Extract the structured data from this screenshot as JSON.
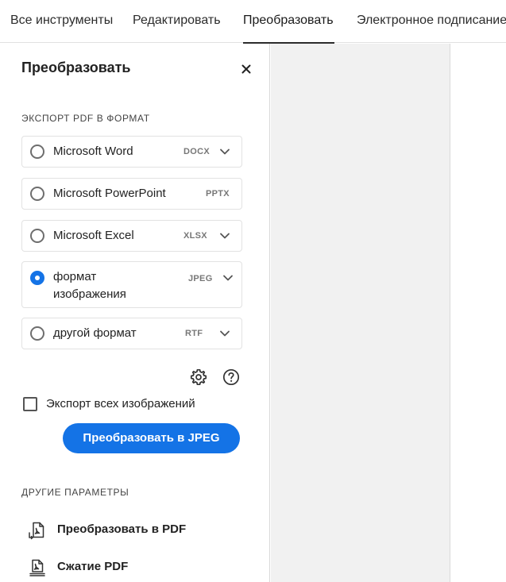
{
  "tabs": [
    {
      "label": "Все инструменты",
      "active": false
    },
    {
      "label": "Редактировать",
      "active": false
    },
    {
      "label": "Преобразовать",
      "active": true
    },
    {
      "label": "Электронное подписание",
      "active": false
    }
  ],
  "panel": {
    "title": "Преобразовать",
    "export_section_label": "ЭКСПОРТ PDF В ФОРМАТ",
    "options": [
      {
        "label": "Microsoft Word",
        "ext": "DOCX",
        "selected": false,
        "has_dropdown": true
      },
      {
        "label": "Microsoft PowerPoint",
        "ext": "PPTX",
        "selected": false,
        "has_dropdown": false
      },
      {
        "label": "Microsoft Excel",
        "ext": "XLSX",
        "selected": false,
        "has_dropdown": true
      },
      {
        "label": "формат изображения",
        "ext": "JPEG",
        "selected": true,
        "has_dropdown": true
      },
      {
        "label": "другой формат",
        "ext": "RTF",
        "selected": false,
        "has_dropdown": true
      }
    ],
    "export_all_images_label": "Экспорт всех изображений",
    "export_all_images_checked": false,
    "convert_button_label": "Преобразовать в JPEG",
    "other_section_label": "ДРУГИЕ ПАРАМЕТРЫ",
    "links": [
      {
        "label": "Преобразовать в PDF",
        "icon": "convert-to-pdf-icon"
      },
      {
        "label": "Сжатие PDF",
        "icon": "compress-pdf-icon"
      }
    ]
  },
  "colors": {
    "accent": "#1473e6",
    "doc_background": "#f1f1f1",
    "border": "#e2e2e2"
  }
}
